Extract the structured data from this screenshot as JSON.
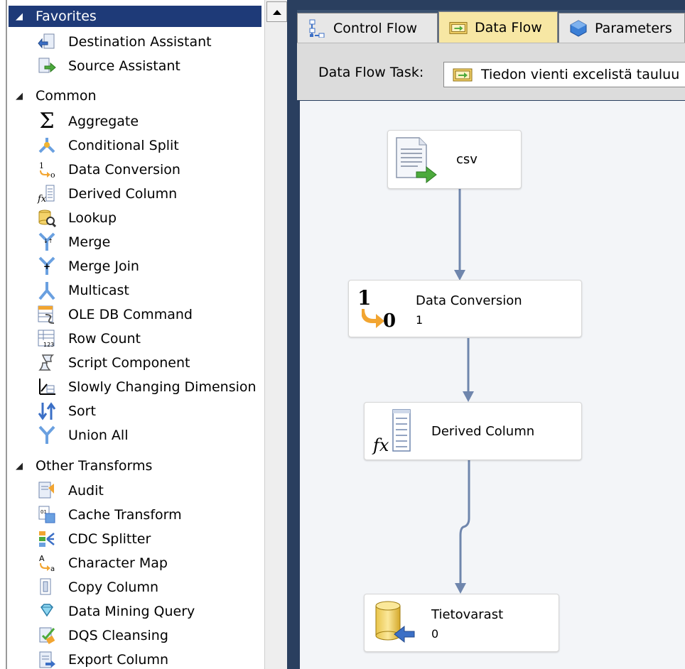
{
  "toolbox": {
    "groups": [
      {
        "label": "Favorites",
        "selected": true
      },
      {
        "label": "Common",
        "selected": false
      },
      {
        "label": "Other Transforms",
        "selected": false
      }
    ],
    "favorites": [
      {
        "label": "Destination Assistant",
        "icon": "destination-assistant-icon"
      },
      {
        "label": "Source Assistant",
        "icon": "source-assistant-icon"
      }
    ],
    "common": [
      {
        "label": "Aggregate",
        "icon": "sigma-icon"
      },
      {
        "label": "Conditional Split",
        "icon": "conditional-split-icon"
      },
      {
        "label": "Data Conversion",
        "icon": "data-conversion-icon"
      },
      {
        "label": "Derived Column",
        "icon": "derived-column-icon"
      },
      {
        "label": "Lookup",
        "icon": "lookup-icon"
      },
      {
        "label": "Merge",
        "icon": "merge-icon"
      },
      {
        "label": "Merge Join",
        "icon": "merge-join-icon"
      },
      {
        "label": "Multicast",
        "icon": "multicast-icon"
      },
      {
        "label": "OLE DB Command",
        "icon": "ole-db-command-icon"
      },
      {
        "label": "Row Count",
        "icon": "row-count-icon"
      },
      {
        "label": "Script Component",
        "icon": "script-component-icon"
      },
      {
        "label": "Slowly Changing Dimension",
        "icon": "slowly-changing-dimension-icon"
      },
      {
        "label": "Sort",
        "icon": "sort-icon"
      },
      {
        "label": "Union All",
        "icon": "union-all-icon"
      }
    ],
    "other": [
      {
        "label": "Audit",
        "icon": "audit-icon"
      },
      {
        "label": "Cache Transform",
        "icon": "cache-transform-icon"
      },
      {
        "label": "CDC Splitter",
        "icon": "cdc-splitter-icon"
      },
      {
        "label": "Character Map",
        "icon": "character-map-icon"
      },
      {
        "label": "Copy Column",
        "icon": "copy-column-icon"
      },
      {
        "label": "Data Mining Query",
        "icon": "data-mining-query-icon"
      },
      {
        "label": "DQS Cleansing",
        "icon": "dqs-cleansing-icon"
      },
      {
        "label": "Export Column",
        "icon": "export-column-icon"
      }
    ]
  },
  "tabs": [
    {
      "label": "Control Flow",
      "active": false,
      "icon": "control-flow-icon"
    },
    {
      "label": "Data Flow",
      "active": true,
      "icon": "data-flow-icon"
    },
    {
      "label": "Parameters",
      "active": false,
      "icon": "parameters-icon"
    }
  ],
  "task": {
    "label": "Data Flow Task:",
    "value": "Tiedon vienti excelistä tauluu"
  },
  "components": {
    "source": {
      "name": "csv",
      "icon": "flat-file-source-icon"
    },
    "conversion": {
      "name": "Data Conversion",
      "sub": "1",
      "icon_top": "1",
      "icon_bottom": "0"
    },
    "derived": {
      "name": "Derived Column",
      "icon": "derived-column-icon"
    },
    "destination": {
      "name": "Tietovarast",
      "sub": "0",
      "icon": "database-destination-icon"
    }
  },
  "colors": {
    "selection": "#1e3a78",
    "frame": "#2a3f5f",
    "canvas": "#f3f5f8",
    "connector": "#6f86ad",
    "active_tab": "#f7e7a4"
  }
}
